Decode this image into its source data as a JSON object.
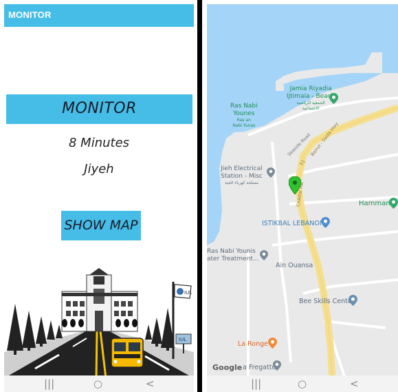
{
  "left_screen": {
    "app_title": "MONITOR",
    "banner_title": "MONITOR",
    "time": "8 Minutes",
    "place": "Jiyeh",
    "show_map_label": "SHOW MAP",
    "flag_text": "IUL",
    "bus_sign_text": "IUL"
  },
  "right_screen": {
    "poi": {
      "jamia_line1": "Jamia Riyadia",
      "jamia_line2": "Ijtimaia - Beach",
      "jamia_ar1": "الجمعية الرياضية",
      "jamia_ar2": "الاجتماعية",
      "ras_line1": "Ras Nabi",
      "ras_line2": "Younes",
      "ras_alt1": "Ras an",
      "ras_alt2": "Nabi Yunas",
      "jieh_line1": "Jieh Electrical",
      "jieh_line2": "Station - Misc",
      "jieh_ar": "مصلحة كهرباء الجية",
      "hammam": "Hammam",
      "istikbal": "ISTIKBAL LEBANON",
      "ras_treat_line1": "Ras Nabi Younis",
      "ras_treat_line2": "ater Treatment...",
      "ain_ouansa": "Ain Ouansa",
      "bee_skills": "Bee Skills Center",
      "la_ronge": "La Ronge",
      "fregatte": "a Fregatte"
    },
    "roads": {
      "seaside": "Seaside Road",
      "beirut_saida": "Beirut - Saida Hwy",
      "coastal": "Coastal Hw",
      "route_51": "51"
    },
    "google_logo": "Google"
  },
  "nav": {
    "recent": "|||",
    "home": "○",
    "back": "<"
  },
  "colors": {
    "appbar": "#45bde6",
    "water": "#a4d4f7",
    "highway": "#f5df8e",
    "pin": "#2fc12f"
  }
}
